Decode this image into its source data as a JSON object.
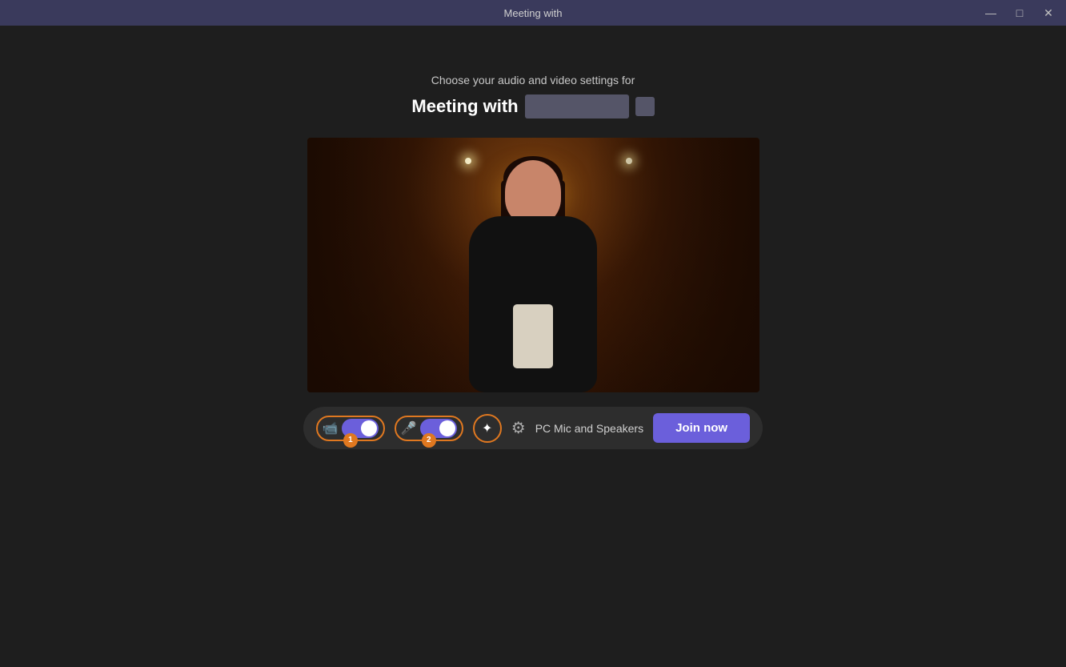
{
  "titleBar": {
    "title": "Meeting with",
    "minimizeBtn": "—",
    "restoreBtn": "□",
    "closeBtn": "✕"
  },
  "header": {
    "subtitle": "Choose your audio and video settings for",
    "meetingTitle": "Meeting with"
  },
  "controls": {
    "cameraToggle": "on",
    "micToggle": "on",
    "audioDevice": "PC Mic and Speakers",
    "joinLabel": "Join now",
    "cameraBadge": "1",
    "effectsBadge": "2"
  }
}
